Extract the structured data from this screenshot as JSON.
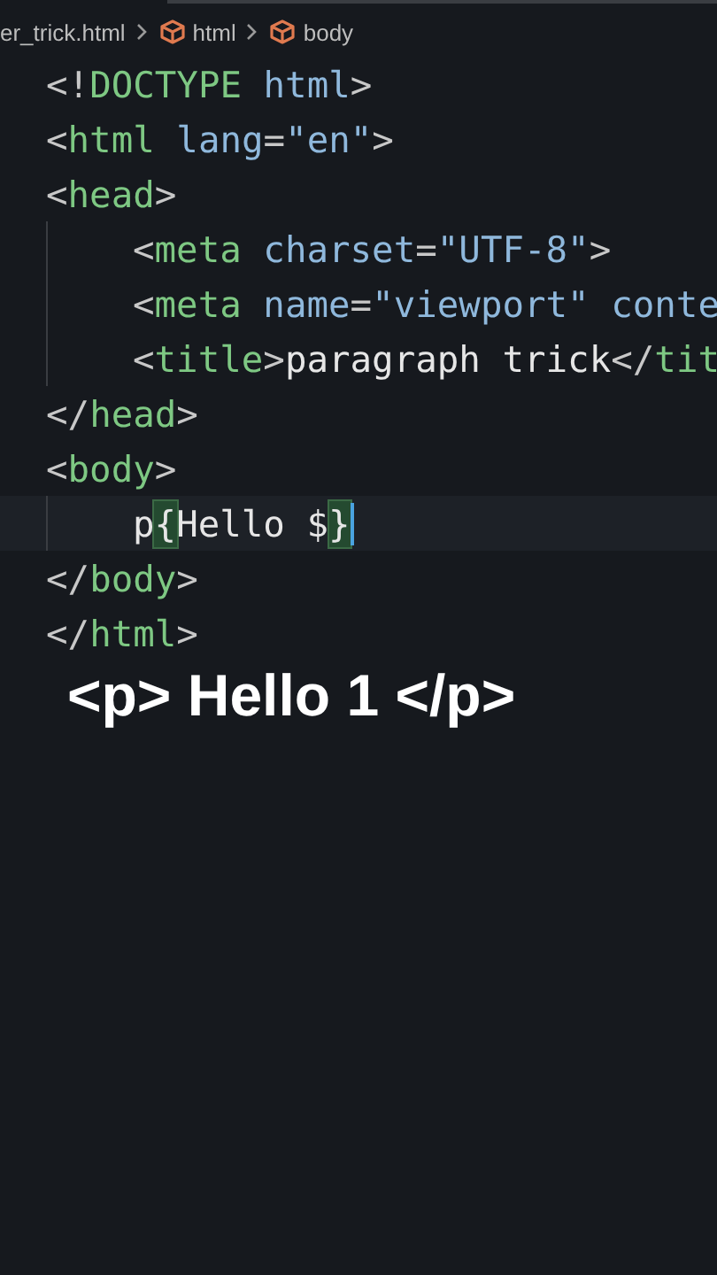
{
  "breadcrumb": [
    {
      "label": "er_trick.html",
      "kind": "file"
    },
    {
      "label": "html",
      "kind": "element"
    },
    {
      "label": "body",
      "kind": "element"
    }
  ],
  "lines": [
    {
      "indented": false,
      "current": false,
      "tokens": [
        {
          "kind": "punct",
          "text": "<!"
        },
        {
          "kind": "tag",
          "text": "DOCTYPE"
        },
        {
          "kind": "attr",
          "text": " html"
        },
        {
          "kind": "punct",
          "text": ">"
        }
      ]
    },
    {
      "indented": false,
      "current": false,
      "tokens": [
        {
          "kind": "punct",
          "text": "<"
        },
        {
          "kind": "tag",
          "text": "html"
        },
        {
          "kind": "attr",
          "text": " lang"
        },
        {
          "kind": "punct",
          "text": "="
        },
        {
          "kind": "string",
          "text": "\"en\""
        },
        {
          "kind": "punct",
          "text": ">"
        }
      ]
    },
    {
      "indented": false,
      "current": false,
      "tokens": [
        {
          "kind": "punct",
          "text": "<"
        },
        {
          "kind": "tag",
          "text": "head"
        },
        {
          "kind": "punct",
          "text": ">"
        }
      ]
    },
    {
      "indented": true,
      "current": false,
      "tokens": [
        {
          "kind": "punct",
          "text": "<"
        },
        {
          "kind": "tag",
          "text": "meta"
        },
        {
          "kind": "attr",
          "text": " charset"
        },
        {
          "kind": "punct",
          "text": "="
        },
        {
          "kind": "string",
          "text": "\"UTF-8\""
        },
        {
          "kind": "punct",
          "text": ">"
        }
      ]
    },
    {
      "indented": true,
      "current": false,
      "tokens": [
        {
          "kind": "punct",
          "text": "<"
        },
        {
          "kind": "tag",
          "text": "meta"
        },
        {
          "kind": "attr",
          "text": " name"
        },
        {
          "kind": "punct",
          "text": "="
        },
        {
          "kind": "string",
          "text": "\"viewport\""
        },
        {
          "kind": "attr",
          "text": " conte"
        }
      ]
    },
    {
      "indented": true,
      "current": false,
      "tokens": [
        {
          "kind": "punct",
          "text": "<"
        },
        {
          "kind": "tag",
          "text": "title"
        },
        {
          "kind": "punct",
          "text": ">"
        },
        {
          "kind": "text",
          "text": "paragraph trick"
        },
        {
          "kind": "punct",
          "text": "</"
        },
        {
          "kind": "tag",
          "text": "tit"
        }
      ]
    },
    {
      "indented": false,
      "current": false,
      "tokens": [
        {
          "kind": "punct",
          "text": "</"
        },
        {
          "kind": "tag",
          "text": "head"
        },
        {
          "kind": "punct",
          "text": ">"
        }
      ]
    },
    {
      "indented": false,
      "current": false,
      "tokens": [
        {
          "kind": "punct",
          "text": "<"
        },
        {
          "kind": "tag",
          "text": "body"
        },
        {
          "kind": "punct",
          "text": ">"
        }
      ]
    },
    {
      "indented": true,
      "current": true,
      "tokens": [
        {
          "kind": "text",
          "text": "p"
        },
        {
          "kind": "bracket",
          "text": "{"
        },
        {
          "kind": "text",
          "text": "Hello $"
        },
        {
          "kind": "bracket",
          "text": "}"
        }
      ]
    },
    {
      "indented": false,
      "current": false,
      "tokens": [
        {
          "kind": "punct",
          "text": "</"
        },
        {
          "kind": "tag",
          "text": "body"
        },
        {
          "kind": "punct",
          "text": ">"
        }
      ]
    },
    {
      "indented": false,
      "current": false,
      "tokens": [
        {
          "kind": "punct",
          "text": "</"
        },
        {
          "kind": "tag",
          "text": "html"
        },
        {
          "kind": "punct",
          "text": ">"
        }
      ]
    }
  ],
  "caption": "<p> Hello 1 </p>"
}
